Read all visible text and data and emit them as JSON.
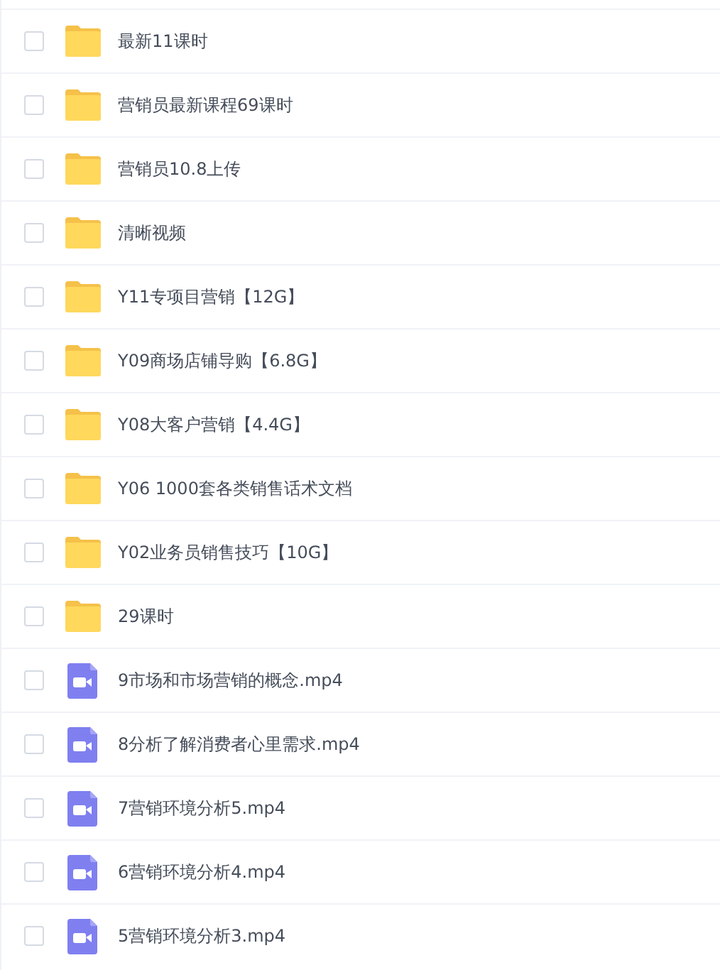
{
  "files": [
    {
      "name": "最新11课时",
      "kind": "folder",
      "selected": false
    },
    {
      "name": "营销员最新课程69课时",
      "kind": "folder",
      "selected": false
    },
    {
      "name": "营销员10.8上传",
      "kind": "folder",
      "selected": false
    },
    {
      "name": "清晰视频",
      "kind": "folder",
      "selected": false
    },
    {
      "name": "Y11专项目营销【12G】",
      "kind": "folder",
      "selected": false
    },
    {
      "name": "Y09商场店铺导购【6.8G】",
      "kind": "folder",
      "selected": false
    },
    {
      "name": "Y08大客户营销【4.4G】",
      "kind": "folder",
      "selected": false
    },
    {
      "name": "Y06 1000套各类销售话术文档",
      "kind": "folder",
      "selected": false
    },
    {
      "name": "Y02业务员销售技巧【10G】",
      "kind": "folder",
      "selected": false
    },
    {
      "name": "29课时",
      "kind": "folder",
      "selected": false
    },
    {
      "name": "9市场和市场营销的概念.mp4",
      "kind": "video",
      "selected": false
    },
    {
      "name": "8分析了解消费者心里需求.mp4",
      "kind": "video",
      "selected": false
    },
    {
      "name": "7营销环境分析5.mp4",
      "kind": "video",
      "selected": false
    },
    {
      "name": "6营销环境分析4.mp4",
      "kind": "video",
      "selected": false
    },
    {
      "name": "5营销环境分析3.mp4",
      "kind": "video",
      "selected": false
    }
  ]
}
